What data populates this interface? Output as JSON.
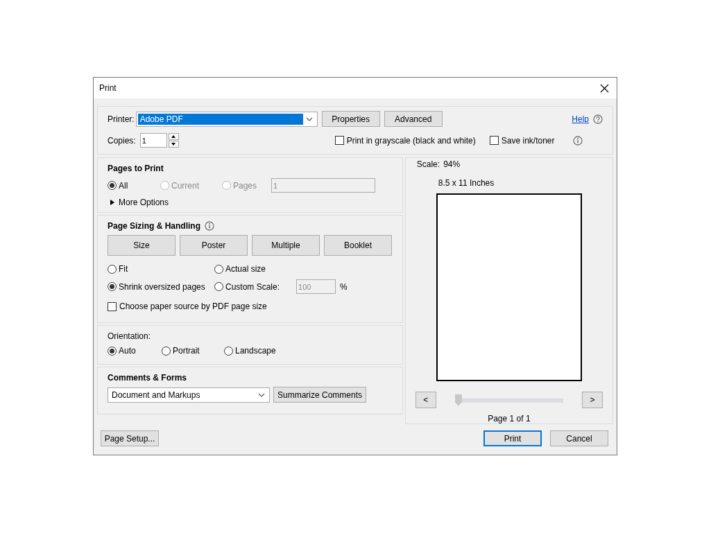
{
  "window": {
    "title": "Print"
  },
  "printer": {
    "label": "Printer:",
    "value": "Adobe PDF",
    "buttons": [
      "Properties",
      "Advanced"
    ],
    "help": "Help"
  },
  "copies": {
    "label": "Copies:",
    "value": "1"
  },
  "options": [
    {
      "label": "Print in grayscale (black and white)",
      "checked": false
    },
    {
      "label": "Save ink/toner",
      "checked": false
    }
  ],
  "pages_to_print": {
    "title": "Pages to Print",
    "options": [
      {
        "label": "All",
        "selected": true,
        "disabled": false
      },
      {
        "label": "Current",
        "selected": false,
        "disabled": true
      },
      {
        "label": "Pages",
        "selected": false,
        "disabled": true
      }
    ],
    "pages_value": "1",
    "more_options": {
      "label": "More Options",
      "expanded": false
    }
  },
  "page_sizing": {
    "title": "Page Sizing & Handling",
    "modes": [
      "Size",
      "Poster",
      "Multiple",
      "Booklet"
    ],
    "scaling": [
      {
        "label": "Fit",
        "selected": false
      },
      {
        "label": "Actual size",
        "selected": false
      },
      {
        "label": "Shrink oversized pages",
        "selected": true
      },
      {
        "label": "Custom Scale:",
        "selected": false,
        "value": "100",
        "unit": "%"
      }
    ],
    "paper_source": {
      "label": "Choose paper source by PDF page size",
      "checked": false
    }
  },
  "orientation": {
    "title": "Orientation:",
    "options": [
      {
        "label": "Auto",
        "selected": true
      },
      {
        "label": "Portrait",
        "selected": false
      },
      {
        "label": "Landscape",
        "selected": false
      }
    ]
  },
  "comments": {
    "title": "Comments & Forms",
    "value": "Document and Markups",
    "button": "Summarize Comments"
  },
  "preview": {
    "scale_label": "Scale:",
    "scale": "94%",
    "paper": "8.5 x 11 Inches",
    "prev": "<",
    "next": ">",
    "level": 0,
    "page": "Page 1 of 1"
  },
  "footer": {
    "page_setup": "Page Setup...",
    "print": "Print",
    "cancel": "Cancel"
  }
}
